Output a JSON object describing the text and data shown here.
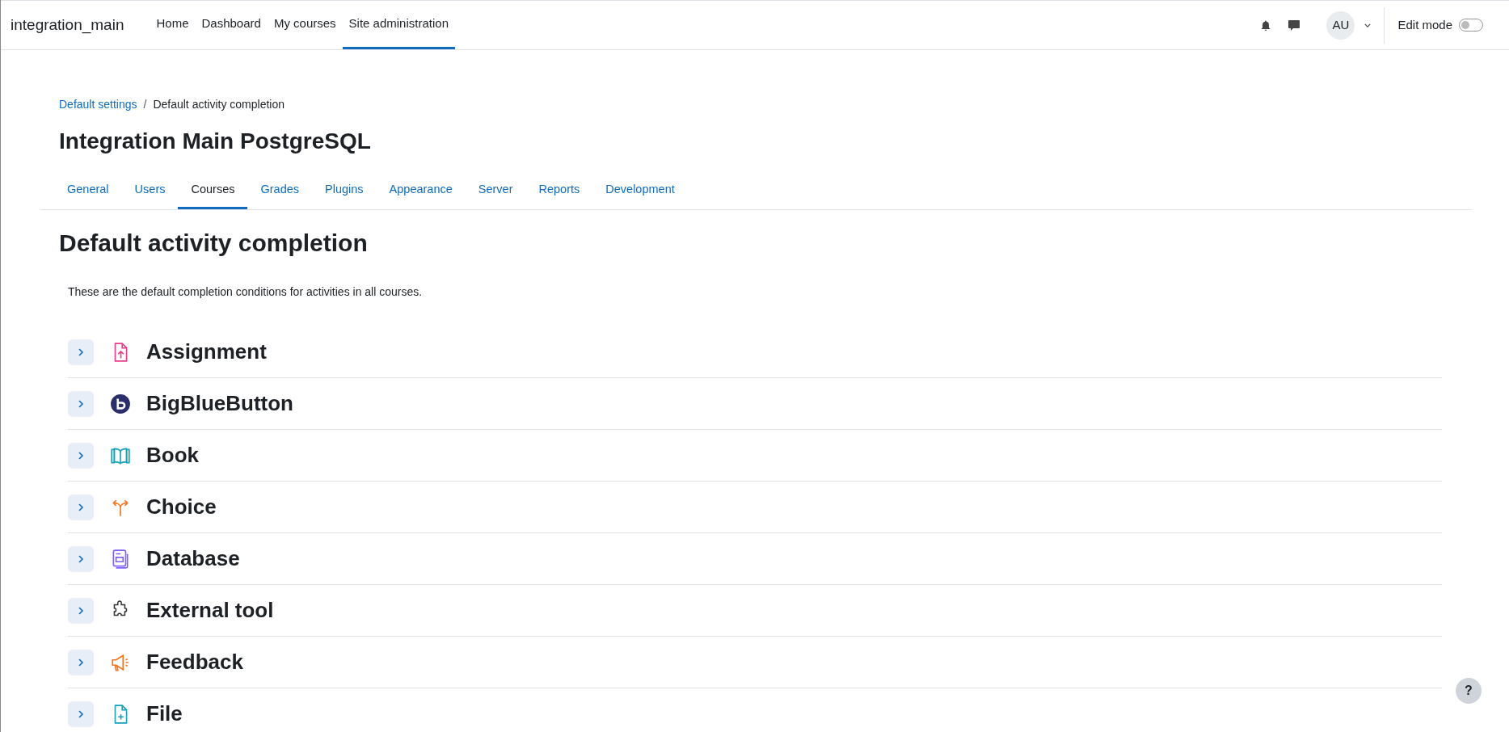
{
  "site_name": "integration_main",
  "primary_nav": [
    {
      "label": "Home",
      "selected": false
    },
    {
      "label": "Dashboard",
      "selected": false
    },
    {
      "label": "My courses",
      "selected": false
    },
    {
      "label": "Site administration",
      "selected": true
    }
  ],
  "user_menu": {
    "initials": "AU"
  },
  "edit_mode": {
    "label": "Edit mode",
    "on": false
  },
  "breadcrumb_separator": "/",
  "breadcrumb": [
    {
      "label": "Default settings",
      "kind": "link"
    },
    {
      "label": "Default activity completion",
      "kind": "current"
    }
  ],
  "site_title": "Integration Main PostgreSQL",
  "admin_tabs": [
    {
      "label": "General",
      "selected": false
    },
    {
      "label": "Users",
      "selected": false
    },
    {
      "label": "Courses",
      "selected": true
    },
    {
      "label": "Grades",
      "selected": false
    },
    {
      "label": "Plugins",
      "selected": false
    },
    {
      "label": "Appearance",
      "selected": false
    },
    {
      "label": "Server",
      "selected": false
    },
    {
      "label": "Reports",
      "selected": false
    },
    {
      "label": "Development",
      "selected": false
    }
  ],
  "page_heading": "Default activity completion",
  "description": "These are the default completion conditions for activities in all courses.",
  "activities": [
    {
      "name": "Assignment",
      "expanded": false
    },
    {
      "name": "BigBlueButton",
      "expanded": false
    },
    {
      "name": "Book",
      "expanded": false
    },
    {
      "name": "Choice",
      "expanded": false
    },
    {
      "name": "Database",
      "expanded": false
    },
    {
      "name": "External tool",
      "expanded": false
    },
    {
      "name": "Feedback",
      "expanded": false
    },
    {
      "name": "File",
      "expanded": false
    }
  ],
  "help_button": {
    "label": "?"
  }
}
